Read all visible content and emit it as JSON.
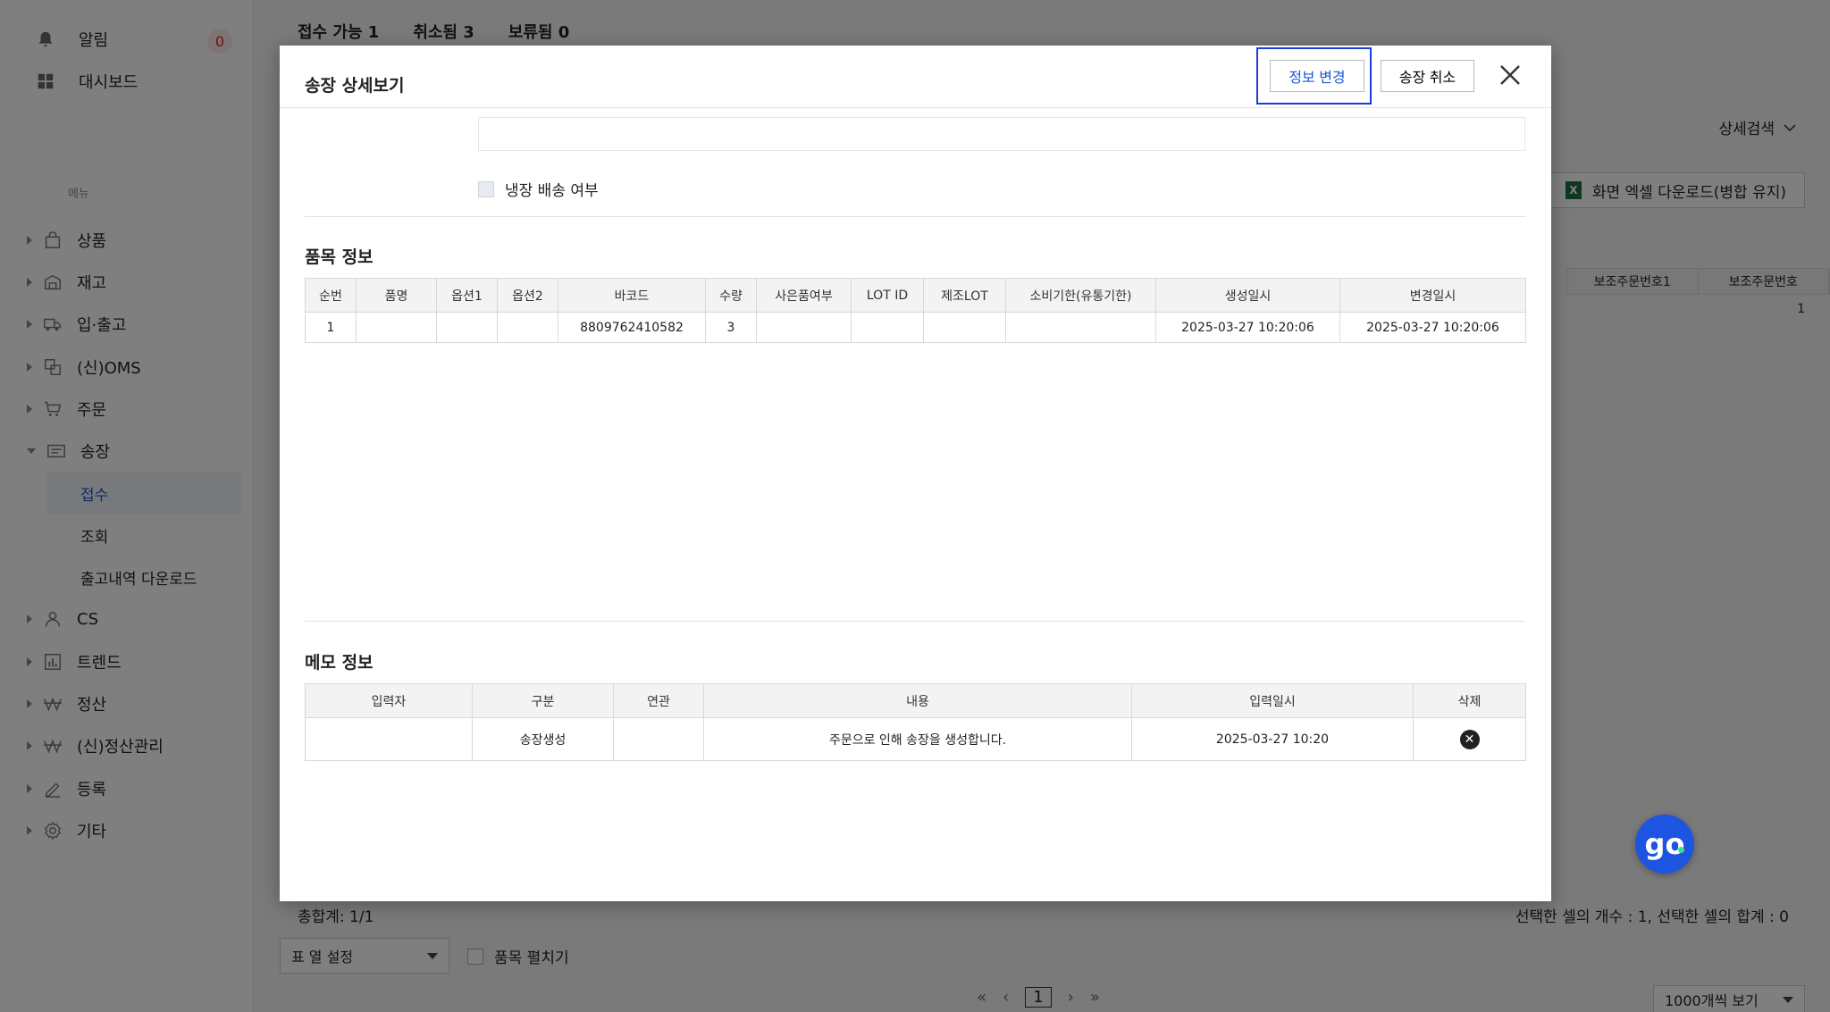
{
  "sidebar": {
    "alert_label": "알림",
    "alert_count": "0",
    "dashboard_label": "대시보드",
    "section_label": "메뉴",
    "items": [
      {
        "label": "상품",
        "icon": "bag-icon"
      },
      {
        "label": "재고",
        "icon": "warehouse-icon"
      },
      {
        "label": "입·출고",
        "icon": "truck-icon"
      },
      {
        "label": "(신)OMS",
        "icon": "oms-icon"
      },
      {
        "label": "주문",
        "icon": "cart-icon"
      },
      {
        "label": "송장",
        "icon": "invoice-icon",
        "expanded": true
      },
      {
        "label": "CS",
        "icon": "person-icon"
      },
      {
        "label": "트렌드",
        "icon": "chart-icon"
      },
      {
        "label": "정산",
        "icon": "won-icon"
      },
      {
        "label": "(신)정산관리",
        "icon": "won-icon"
      },
      {
        "label": "등록",
        "icon": "pen-icon"
      },
      {
        "label": "기타",
        "icon": "gear-icon"
      }
    ],
    "sub_items": [
      {
        "label": "접수",
        "active": true
      },
      {
        "label": "조회"
      },
      {
        "label": "출고내역 다운로드"
      }
    ]
  },
  "background": {
    "tabs": [
      "접수 가능 1",
      "취소됨 3",
      "보류됨 0"
    ],
    "detail_search": "상세검색",
    "excel_button": "화면 엑셀 다운로드(병합 유지)",
    "table_headers": [
      "보조주문번호1",
      "보조주문번호"
    ],
    "table_cell": "1",
    "total": "총합계: 1/1",
    "selected_info": "선택한 셀의 개수 : 1, 선택한 셀의 합계 : 0",
    "column_settings": "표 열 설정",
    "expand_items": "품목 펼치기",
    "current_page": "1",
    "per_page": "1000개씩 보기"
  },
  "modal": {
    "title": "송장 상세보기",
    "edit_button": "정보 변경",
    "cancel_button": "송장 취소",
    "cold_delivery_label": "냉장 배송 여부",
    "items_section": {
      "title": "품목 정보",
      "headers": [
        "순번",
        "품명",
        "옵션1",
        "옵션2",
        "바코드",
        "수량",
        "사은품여부",
        "LOT ID",
        "제조LOT",
        "소비기한(유통기한)",
        "생성일시",
        "변경일시"
      ],
      "rows": [
        [
          "1",
          "",
          "",
          "",
          "8809762410582",
          "3",
          "",
          "",
          "",
          "",
          "2025-03-27 10:20:06",
          "2025-03-27 10:20:06"
        ]
      ]
    },
    "memo_section": {
      "title": "메모 정보",
      "headers": [
        "입력자",
        "구분",
        "연관",
        "내용",
        "입력일시",
        "삭제"
      ],
      "rows": [
        [
          "",
          "송장생성",
          "",
          "주문으로 인해 송장을 생성합니다.",
          "2025-03-27 10:20",
          ""
        ]
      ]
    }
  },
  "chat_button": "go"
}
